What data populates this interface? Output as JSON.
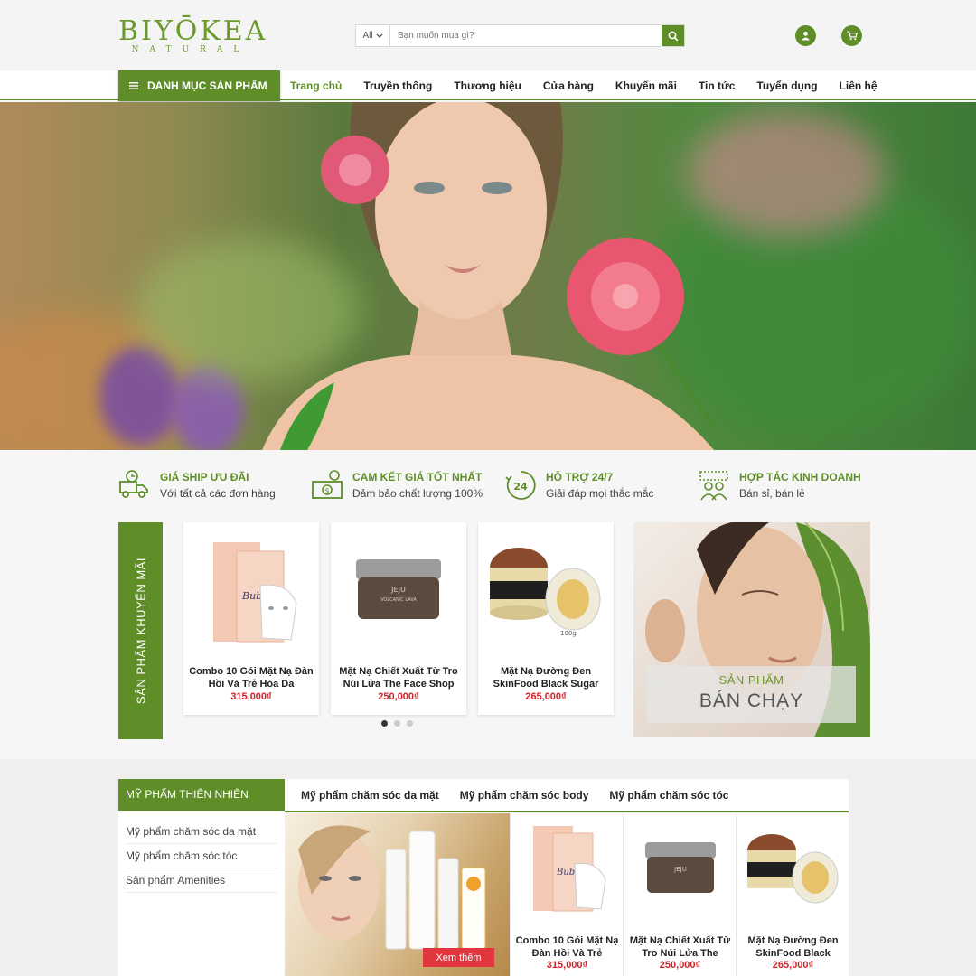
{
  "brand": {
    "name": "BIYŌKEA",
    "tagline": "NATURAL"
  },
  "search": {
    "category": "All",
    "placeholder": "Bạn muốn mua gì?"
  },
  "nav": {
    "category_button": "DANH MỤC SẢN PHẨM",
    "items": [
      "Trang chủ",
      "Truyền thông",
      "Thương hiệu",
      "Cửa hàng",
      "Khuyến mãi",
      "Tin tức",
      "Tuyển dụng",
      "Liên hệ"
    ]
  },
  "features": [
    {
      "title": "GIÁ SHIP ƯU ĐÃI",
      "subtitle": "Với tất cả các đơn hàng",
      "icon": "delivery-truck-icon"
    },
    {
      "title": "CAM KẾT GIÁ TỐT NHẤT",
      "subtitle": "Đảm bảo chất lượng 100%",
      "icon": "money-icon"
    },
    {
      "title": "HỖ TRỢ 24/7",
      "subtitle": "Giải đáp mọi thắc mắc",
      "icon": "support-24-icon"
    },
    {
      "title": "HỢP TÁC KINH DOANH",
      "subtitle": "Bán sỉ, bán lẻ",
      "icon": "partnership-icon"
    }
  ],
  "promo": {
    "label": "SẢN PHẨM KHUYẾN MÃI",
    "products": [
      {
        "name": "Combo 10 Gói Mặt Nạ Đàn Hồi Và Trẻ Hóa Da",
        "price": "315,000₫"
      },
      {
        "name": "Mặt Nạ Chiết Xuất Từ Tro Núi Lửa The Face Shop",
        "price": "250,000₫"
      },
      {
        "name": "Mặt Nạ Đường Đen SkinFood Black Sugar",
        "price": "265,000₫"
      }
    ],
    "active_slide": 1,
    "slide_count": 3
  },
  "banner": {
    "line1": "SẢN PHẨM",
    "line2": "BÁN CHẠY"
  },
  "natural": {
    "heading": "MỸ PHẨM THIÊN NHIÊN",
    "side_items": [
      "Mỹ phẩm chăm sóc da mặt",
      "Mỹ phẩm chăm sóc tóc",
      "Sản phẩm Amenities"
    ],
    "tabs": [
      "Mỹ phẩm chăm sóc da mặt",
      "Mỹ phẩm chăm sóc body",
      "Mỹ phẩm chăm sóc tóc"
    ],
    "more_button": "Xem thêm",
    "products": [
      {
        "name": "Combo 10 Gói Mặt Nạ Đàn Hồi Và Trẻ",
        "price": "315,000₫"
      },
      {
        "name": "Mặt Nạ Chiết Xuất Từ Tro Núi Lửa The",
        "price": "250,000₫"
      },
      {
        "name": "Mặt Nạ Đường Đen SkinFood Black",
        "price": "265,000₫"
      }
    ]
  },
  "colors": {
    "brand_green": "#5f8e29",
    "price_red": "#d0242a"
  }
}
